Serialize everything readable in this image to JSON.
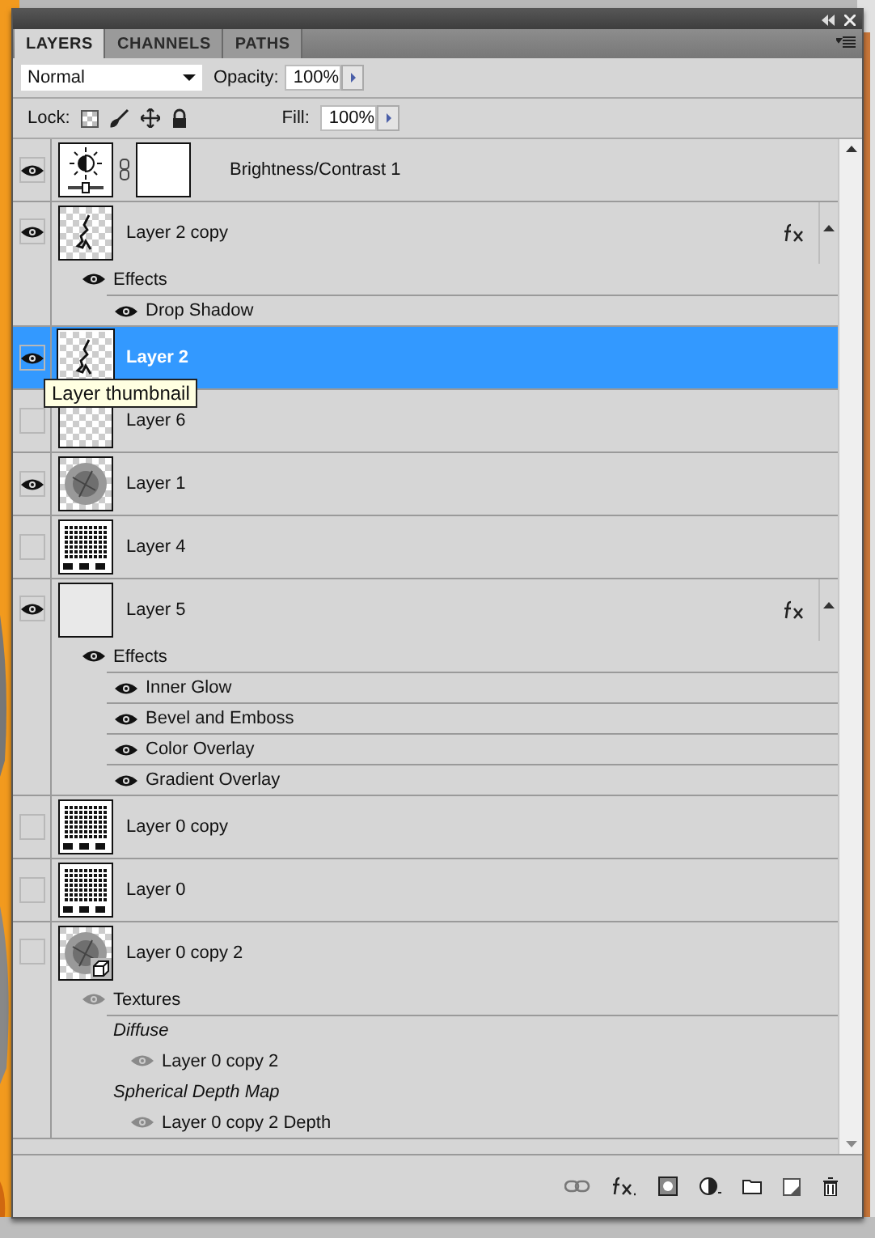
{
  "tabs": [
    {
      "label": "LAYERS",
      "selected": true
    },
    {
      "label": "CHANNELS",
      "selected": false
    },
    {
      "label": "PATHS",
      "selected": false
    }
  ],
  "blend_mode": "Normal",
  "opacity_label": "Opacity:",
  "opacity": "100%",
  "lock_label": "Lock:",
  "fill_label": "Fill:",
  "fill": "100%",
  "layers": [
    {
      "name": "Brightness/Contrast 1",
      "kind": "adjustment",
      "visible": true,
      "selected": false,
      "fx": false
    },
    {
      "name": "Layer 2 copy",
      "kind": "layer",
      "thumbnail": {
        "kind": "figure"
      },
      "visible": true,
      "selected": false,
      "fx": true,
      "effects": {
        "label": "Effects",
        "visible": true,
        "items": [
          {
            "name": "Drop Shadow",
            "visible": true
          }
        ]
      }
    },
    {
      "name": "Layer 2",
      "kind": "layer",
      "thumbnail": {
        "kind": "figure"
      },
      "visible": true,
      "selected": true,
      "fx": false,
      "tooltip": "Layer thumbnail"
    },
    {
      "name": "Layer 6",
      "kind": "layer",
      "thumbnail": {
        "kind": "empty"
      },
      "visible": false,
      "selected": false,
      "fx": false
    },
    {
      "name": "Layer 1",
      "kind": "layer",
      "thumbnail": {
        "kind": "blur"
      },
      "visible": true,
      "selected": false,
      "fx": false
    },
    {
      "name": "Layer 4",
      "kind": "layer",
      "thumbnail": {
        "kind": "pattern"
      },
      "visible": false,
      "selected": false,
      "fx": false
    },
    {
      "name": "Layer 5",
      "kind": "layer",
      "thumbnail": {
        "kind": "plain"
      },
      "visible": true,
      "selected": false,
      "fx": true,
      "effects": {
        "label": "Effects",
        "visible": true,
        "items": [
          {
            "name": "Inner Glow",
            "visible": true
          },
          {
            "name": "Bevel and Emboss",
            "visible": true
          },
          {
            "name": "Color Overlay",
            "visible": true
          },
          {
            "name": "Gradient Overlay",
            "visible": true
          }
        ]
      }
    },
    {
      "name": "Layer 0 copy",
      "kind": "layer",
      "thumbnail": {
        "kind": "pattern"
      },
      "visible": false,
      "selected": false,
      "fx": false
    },
    {
      "name": "Layer 0",
      "kind": "layer",
      "thumbnail": {
        "kind": "pattern"
      },
      "visible": false,
      "selected": false,
      "fx": false
    },
    {
      "name": "Layer 0 copy 2",
      "kind": "model",
      "thumbnail": {
        "kind": "blur"
      },
      "visible": false,
      "selected": false,
      "fx": false,
      "textures": {
        "label": "Textures",
        "visible": false,
        "groups": [
          {
            "label": "Diffuse",
            "items": [
              {
                "name": "Layer 0 copy 2",
                "visible": false
              }
            ]
          },
          {
            "label": "Spherical Depth Map",
            "items": [
              {
                "name": "Layer 0 copy 2 Depth",
                "visible": false
              }
            ]
          }
        ]
      }
    }
  ]
}
